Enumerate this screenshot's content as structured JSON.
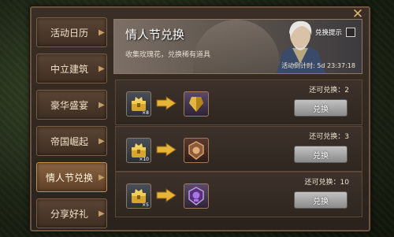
{
  "sidebar": {
    "items": [
      {
        "label": "活动日历",
        "active": false
      },
      {
        "label": "中立建筑",
        "active": false
      },
      {
        "label": "豪华盛宴",
        "active": false
      },
      {
        "label": "帝国崛起",
        "active": false
      },
      {
        "label": "情人节兑换",
        "active": true
      },
      {
        "label": "分享好礼",
        "active": false
      }
    ],
    "arrow": "▶"
  },
  "banner": {
    "title": "情人节兑换",
    "subtitle": "收集玫瑰花，兑换稀有道具",
    "toggle_label": "兑换提示",
    "toggle_checked": false,
    "countdown": "活动倒计时: 5d 23:37:18"
  },
  "close_glyph": "✕",
  "rows": [
    {
      "remaining": "还可兑换：2",
      "button": "兑换",
      "source_qty": "×8",
      "reward_icon": "gold-shield-icon"
    },
    {
      "remaining": "还可兑换：3",
      "button": "兑换",
      "source_qty": "×10",
      "reward_icon": "bronze-emblem-icon"
    },
    {
      "remaining": "还可兑换：10",
      "button": "兑换",
      "source_qty": "×5",
      "reward_icon": "purple-emblem-icon"
    }
  ],
  "colors": {
    "panel": "#2f261f",
    "accent_gold": "#d9b36c",
    "button_gray": "#a8a8a8",
    "active_tab": "#7a5538"
  }
}
